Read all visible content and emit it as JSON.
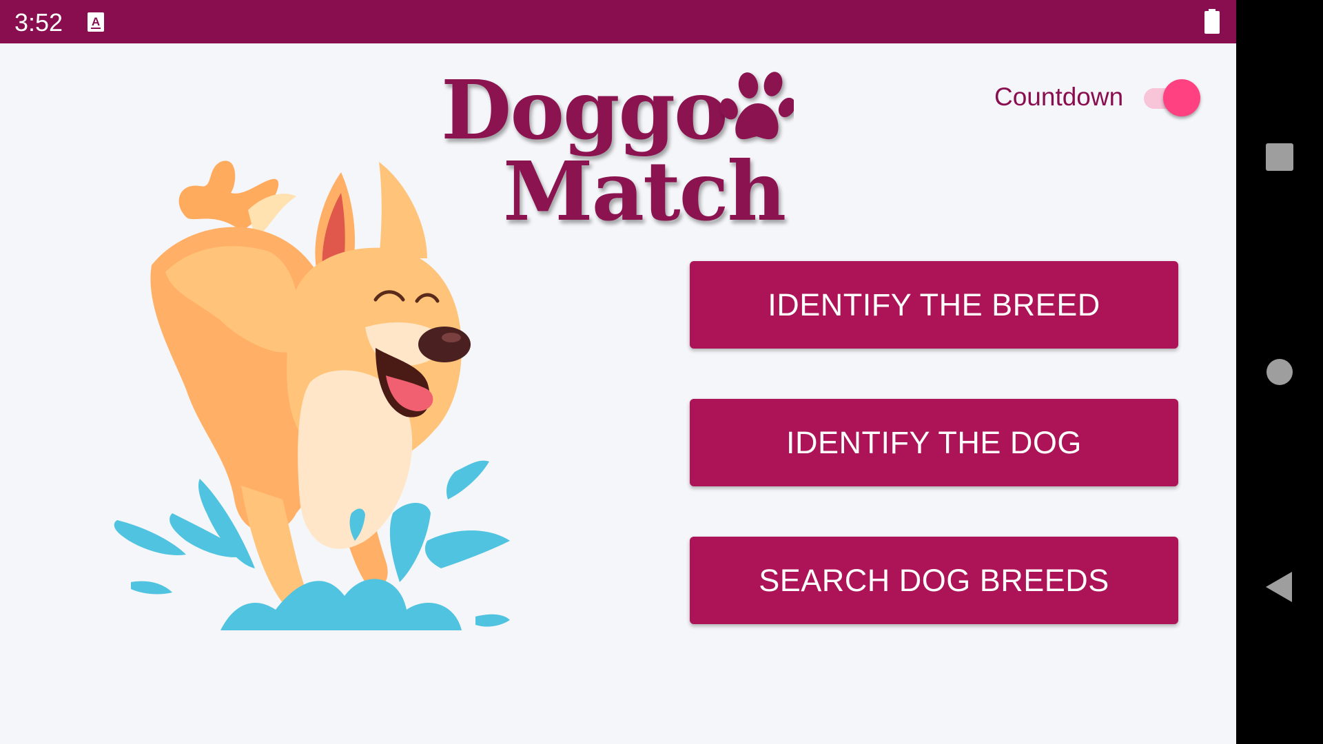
{
  "status_bar": {
    "time": "3:52",
    "icons": [
      "text-a-notification-icon",
      "battery-icon"
    ]
  },
  "app": {
    "logo": {
      "line1": "Doggo",
      "line2": "Match",
      "icon": "paw-icon"
    },
    "countdown": {
      "label": "Countdown",
      "enabled": true
    },
    "buttons": {
      "identify_breed": "IDENTIFY THE BREED",
      "identify_dog": "IDENTIFY THE DOG",
      "search_breeds": "SEARCH DOG BREEDS"
    },
    "illustration": "dog-splash-illustration"
  },
  "navigation": {
    "icons": [
      "recents-icon",
      "home-icon",
      "back-icon"
    ]
  },
  "colors": {
    "status_bar": "#880e4f",
    "button": "#ad1457",
    "toggle_thumb": "#ff4081",
    "toggle_track": "#f7c4d8",
    "background": "#f5f6f9",
    "splash": "#4fc3e0",
    "dog_fur": "#ffc37a"
  }
}
